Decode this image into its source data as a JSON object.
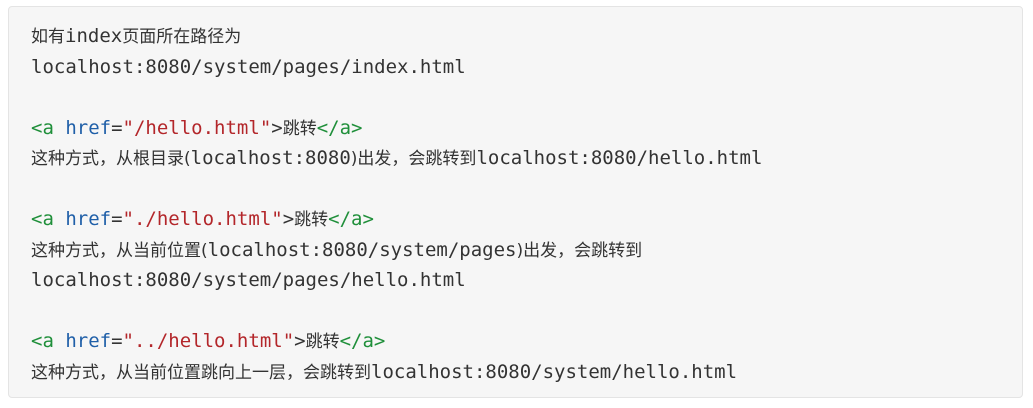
{
  "intro": {
    "prefix": "如有",
    "code": "index",
    "suffix": "页面所在路径为",
    "path": "localhost:8080/system/pages/index.html"
  },
  "examples": [
    {
      "tag_open": "<a ",
      "attr": "href",
      "eq": "=",
      "value": "\"/hello.html\"",
      "close_bracket": ">",
      "link_text": "跳转",
      "tag_close": "</a>",
      "desc_cjk1": "这种方式，从根目录(",
      "desc_code1": "localhost:8080",
      "desc_cjk2": ")出发，会跳转到",
      "desc_code2": "localhost:8080/hello.html"
    },
    {
      "tag_open": "<a ",
      "attr": "href",
      "eq": "=",
      "value": "\"./hello.html\"",
      "close_bracket": ">",
      "link_text": "跳转",
      "tag_close": "</a>",
      "desc_cjk1": "这种方式，从当前位置(",
      "desc_code1": "localhost:8080/system/pages",
      "desc_cjk2": ")出发，会跳转到",
      "desc_line2": "localhost:8080/system/pages/hello.html"
    },
    {
      "tag_open": "<a ",
      "attr": "href",
      "eq": "=",
      "value": "\"../hello.html\"",
      "close_bracket": ">",
      "link_text": "跳转",
      "tag_close": "</a>",
      "desc_cjk1": "这种方式，从当前位置跳向上一层，会跳转到",
      "desc_code1": "localhost:8080/system/hello.html"
    }
  ],
  "colors": {
    "tag": "#1f8f3a",
    "attr": "#1f5fa8",
    "string": "#b3262a",
    "text": "#333333",
    "background": "#f6f6f6"
  }
}
